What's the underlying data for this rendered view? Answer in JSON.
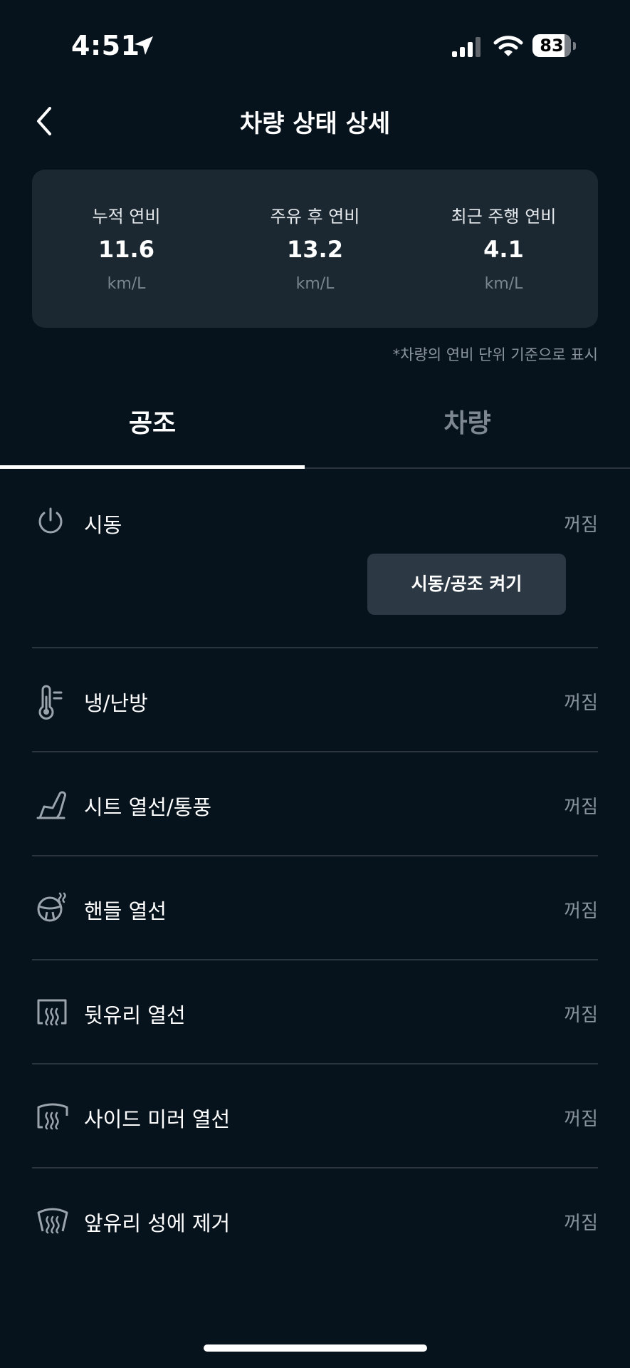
{
  "status_bar": {
    "time": "4:51",
    "battery": "83",
    "icons": [
      "location-arrow-icon",
      "cellular-signal-icon",
      "wifi-icon",
      "battery-icon"
    ]
  },
  "header": {
    "title": "차량 상태 상세",
    "back_icon": "chevron-left-icon"
  },
  "fuel_efficiency": {
    "items": [
      {
        "label": "누적 연비",
        "value": "11.6",
        "unit": "km/L"
      },
      {
        "label": "주유 후 연비",
        "value": "13.2",
        "unit": "km/L"
      },
      {
        "label": "최근 주행 연비",
        "value": "4.1",
        "unit": "km/L"
      }
    ],
    "note": "*차량의 연비 단위 기준으로 표시"
  },
  "tabs": [
    {
      "label": "공조",
      "active": true
    },
    {
      "label": "차량",
      "active": false
    }
  ],
  "climate_items": [
    {
      "label": "시동",
      "status": "꺼짐",
      "icon": "power-icon"
    },
    {
      "label": "냉/난방",
      "status": "꺼짐",
      "icon": "thermometer-icon"
    },
    {
      "label": "시트 열선/통풍",
      "status": "꺼짐",
      "icon": "seat-icon"
    },
    {
      "label": "핸들 열선",
      "status": "꺼짐",
      "icon": "steering-wheel-heat-icon"
    },
    {
      "label": "뒷유리 열선",
      "status": "꺼짐",
      "icon": "rear-defrost-icon"
    },
    {
      "label": "사이드 미러 열선",
      "status": "꺼짐",
      "icon": "mirror-heat-icon"
    },
    {
      "label": "앞유리 성에 제거",
      "status": "꺼짐",
      "icon": "front-defrost-icon"
    }
  ],
  "start_button_label": "시동/공조 켜기",
  "colors": {
    "background": "#06121c",
    "card": "#1b2832",
    "button": "#2c3944",
    "divider": "#2a3540",
    "muted_text": "#8a949e",
    "inactive_tab": "#7d8792",
    "icon": "#9aa4ad"
  }
}
